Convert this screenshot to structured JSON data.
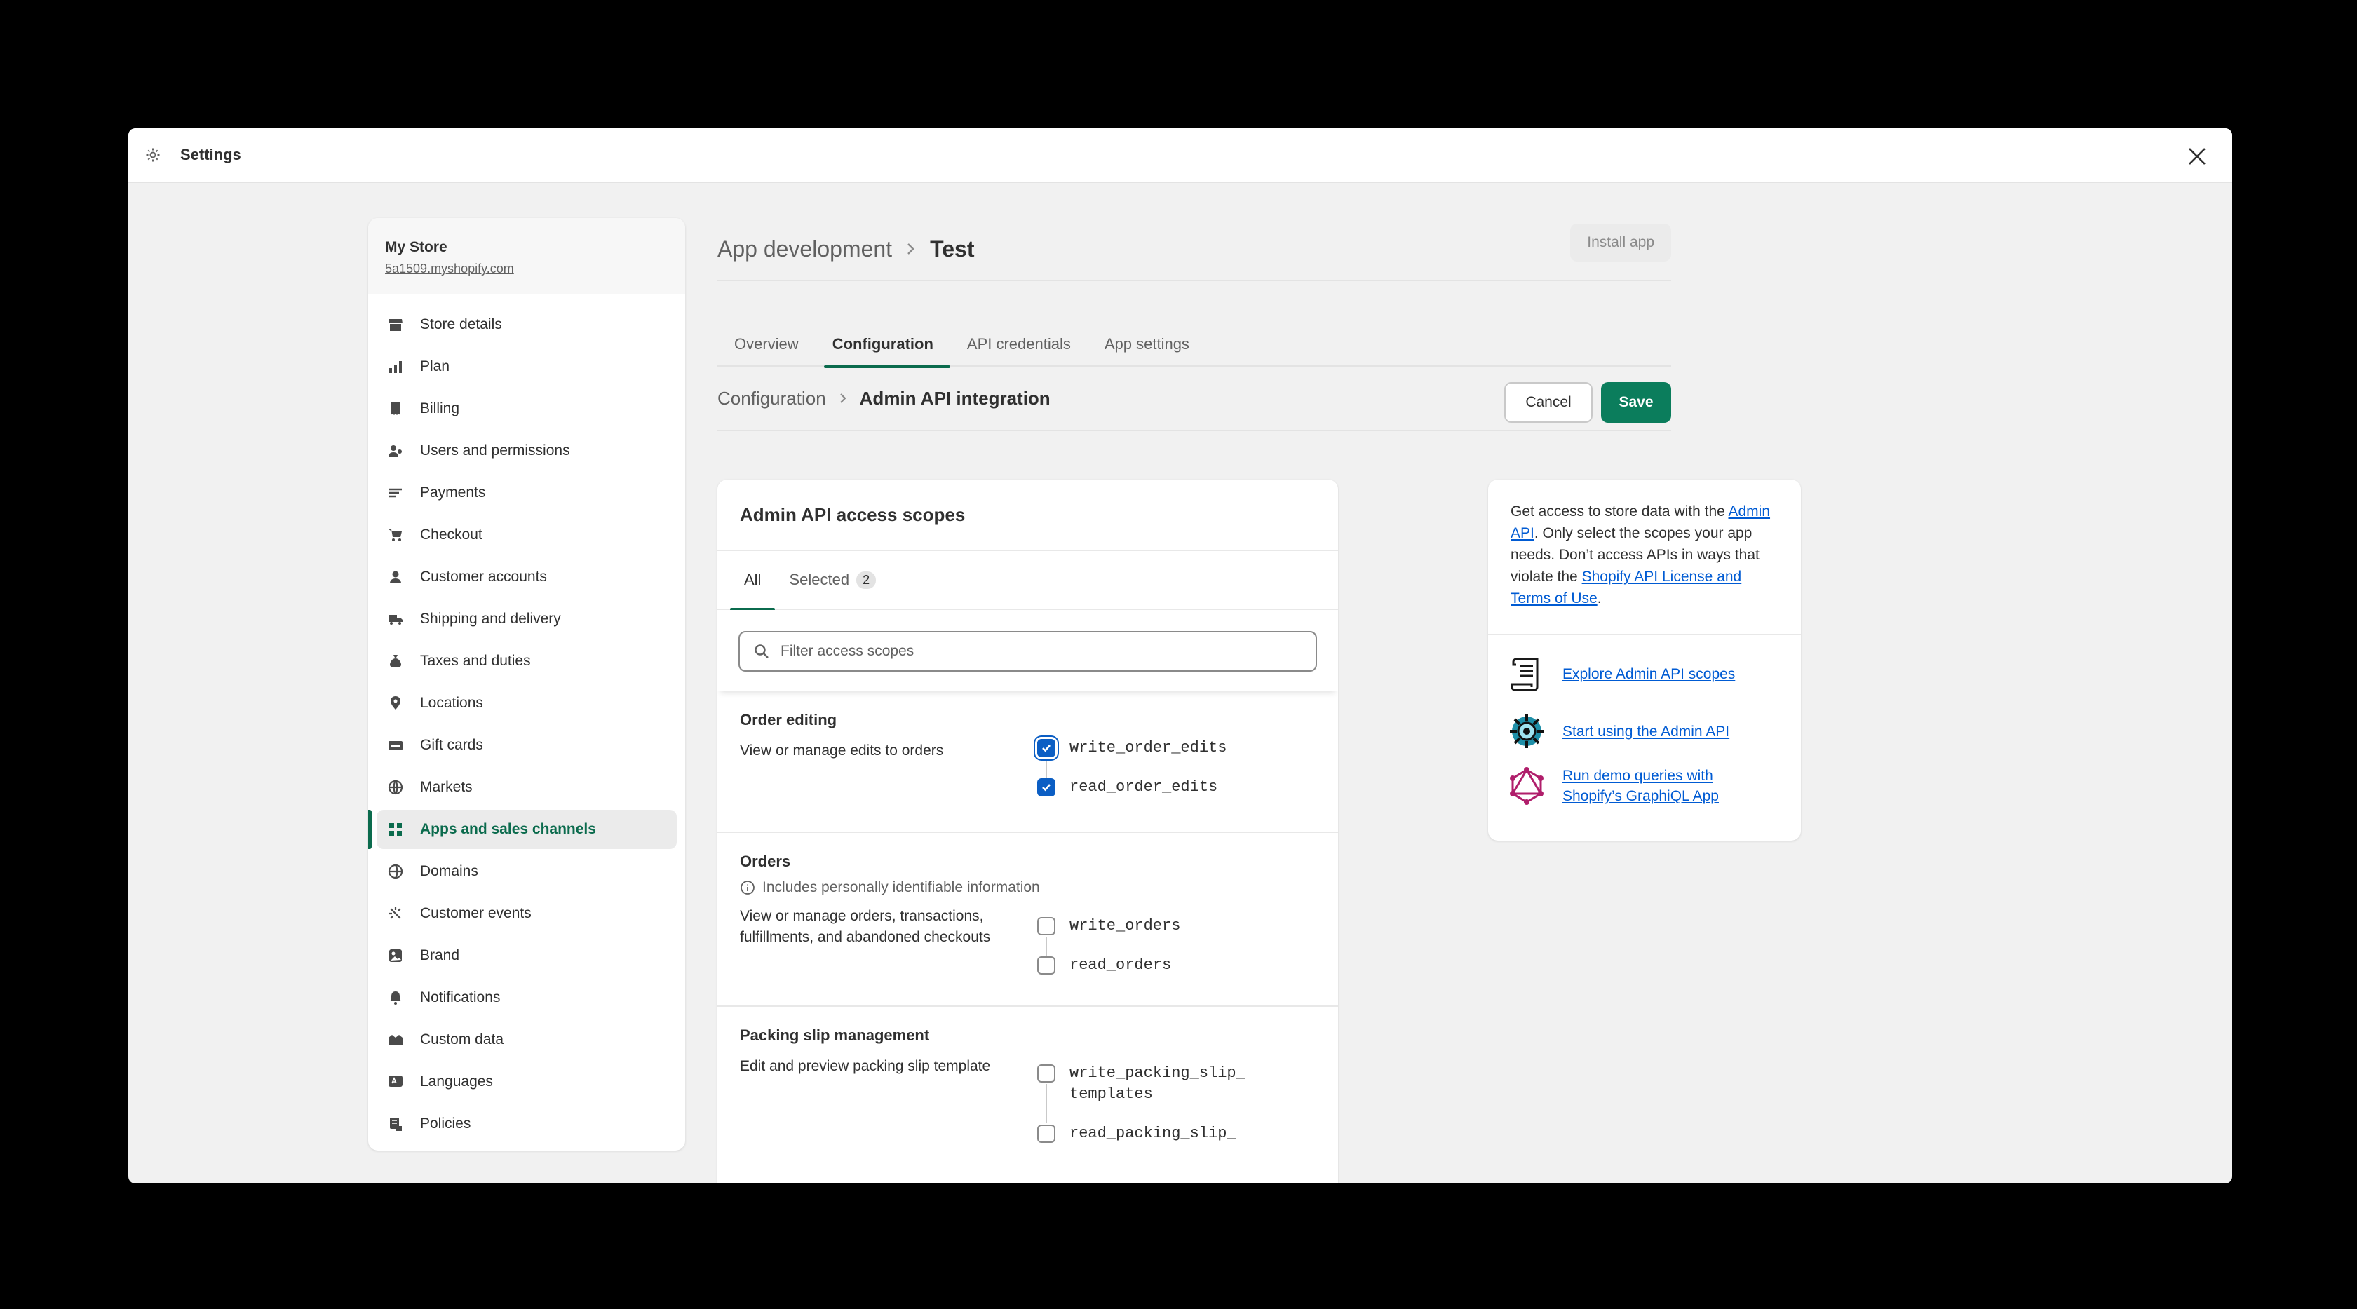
{
  "modal": {
    "title": "Settings"
  },
  "store": {
    "name": "My Store",
    "url": "5a1509.myshopify.com"
  },
  "sidebar": {
    "items": [
      {
        "label": "Store details",
        "icon": "store-icon"
      },
      {
        "label": "Plan",
        "icon": "plan-icon"
      },
      {
        "label": "Billing",
        "icon": "billing-icon"
      },
      {
        "label": "Users and permissions",
        "icon": "users-icon"
      },
      {
        "label": "Payments",
        "icon": "payments-icon"
      },
      {
        "label": "Checkout",
        "icon": "cart-icon"
      },
      {
        "label": "Customer accounts",
        "icon": "person-icon"
      },
      {
        "label": "Shipping and delivery",
        "icon": "truck-icon"
      },
      {
        "label": "Taxes and duties",
        "icon": "tax-icon"
      },
      {
        "label": "Locations",
        "icon": "location-icon"
      },
      {
        "label": "Gift cards",
        "icon": "gift-card-icon"
      },
      {
        "label": "Markets",
        "icon": "globe-icon"
      },
      {
        "label": "Apps and sales channels",
        "icon": "apps-icon",
        "active": true
      },
      {
        "label": "Domains",
        "icon": "domain-icon"
      },
      {
        "label": "Customer events",
        "icon": "events-icon"
      },
      {
        "label": "Brand",
        "icon": "brand-icon"
      },
      {
        "label": "Notifications",
        "icon": "bell-icon"
      },
      {
        "label": "Custom data",
        "icon": "custom-data-icon"
      },
      {
        "label": "Languages",
        "icon": "language-icon"
      },
      {
        "label": "Policies",
        "icon": "policy-icon"
      }
    ]
  },
  "page": {
    "breadcrumb_parent": "App development",
    "title": "Test",
    "install_label": "Install app"
  },
  "tabs": [
    "Overview",
    "Configuration",
    "API credentials",
    "App settings"
  ],
  "subheader": {
    "parent": "Configuration",
    "current": "Admin API integration",
    "cancel_label": "Cancel",
    "save_label": "Save"
  },
  "scopes": {
    "title": "Admin API access scopes",
    "tab_all": "All",
    "tab_selected": "Selected",
    "selected_count": "2",
    "filter_placeholder": "Filter access scopes",
    "groups": [
      {
        "name": "Order editing",
        "desc": "View or manage edits to orders",
        "write": "write_order_edits",
        "read": "read_order_edits",
        "write_checked": true,
        "read_checked": true
      },
      {
        "name": "Orders",
        "pii": "Includes personally identifiable information",
        "desc": "View or manage orders, transactions, fulfillments, and abandoned checkouts",
        "write": "write_orders",
        "read": "read_orders",
        "write_checked": false,
        "read_checked": false
      },
      {
        "name": "Packing slip management",
        "desc": "Edit and preview packing slip template",
        "write_line1": "write_packing_slip_",
        "write_line2": "templates",
        "read": "read_packing_slip_",
        "write_checked": false,
        "read_checked": false
      }
    ]
  },
  "info": {
    "text_1": "Get access to store data with the ",
    "link_admin_api": "Admin API",
    "text_2": ". Only select the scopes your app needs. Don’t access APIs in ways that violate the ",
    "link_license": "Shopify API License and Terms of Use",
    "text_3": ".",
    "resources": [
      {
        "label": "Explore Admin API scopes",
        "icon": "scroll-icon"
      },
      {
        "label": "Start using the Admin API",
        "icon": "gear-badge-icon"
      },
      {
        "label_line1": "Run demo queries with",
        "label_line2": "Shopify’s GraphiQL App",
        "icon": "graphql-icon"
      }
    ]
  },
  "colors": {
    "accent": "#0b6b4d",
    "save": "#0b7d5c",
    "link": "#005bd3",
    "checkbox": "#0b5ec4"
  }
}
